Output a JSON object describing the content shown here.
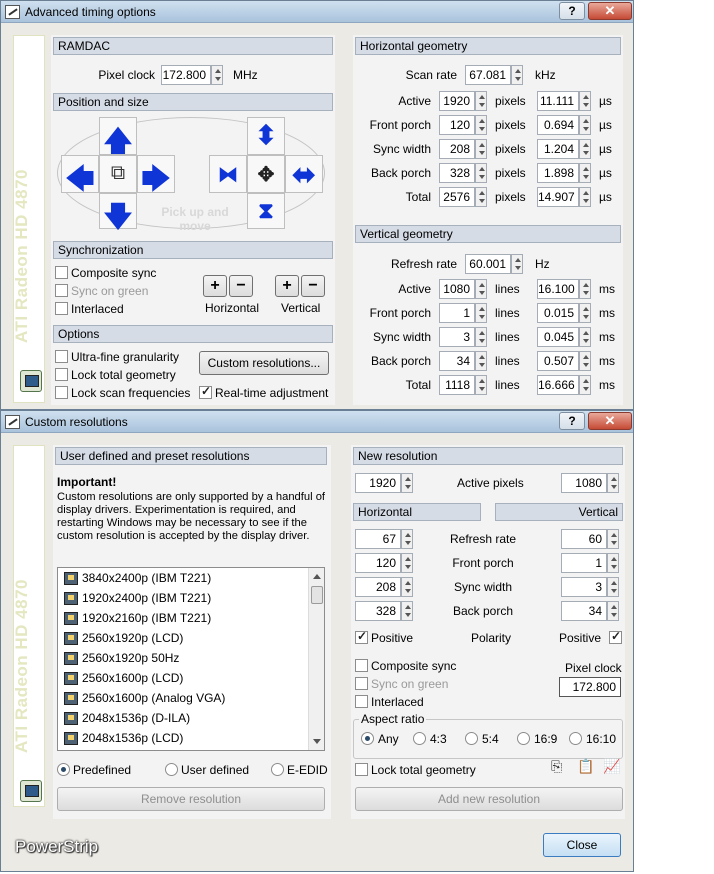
{
  "win1": {
    "title": "Advanced timing options",
    "help": "?",
    "close": "✕",
    "sidebar": "ATI Radeon HD 4870",
    "ramdac": {
      "header": "RAMDAC",
      "pixel_clock_label": "Pixel clock",
      "pixel_clock": "172.800",
      "unit": "MHz"
    },
    "position": {
      "header": "Position and size",
      "pickup": "Pick up and move"
    },
    "sync": {
      "header": "Synchronization",
      "composite": "Composite sync",
      "sync_on_green": "Sync on green",
      "interlaced": "Interlaced",
      "horizontal": "Horizontal",
      "vertical": "Vertical",
      "plus": "+",
      "minus": "−"
    },
    "options": {
      "header": "Options",
      "ultra_fine": "Ultra-fine granularity",
      "lock_total": "Lock total geometry",
      "lock_scan": "Lock scan frequencies",
      "custom_btn": "Custom resolutions...",
      "realtime": "Real-time adjustment"
    },
    "hgeo": {
      "header": "Horizontal geometry",
      "scan_label": "Scan rate",
      "scan": "67.081",
      "scan_unit": "kHz",
      "rows": [
        {
          "label": "Active",
          "value": "1920",
          "unit": "pixels",
          "time": "11.111",
          "tunit": "µs"
        },
        {
          "label": "Front porch",
          "value": "120",
          "unit": "pixels",
          "time": "0.694",
          "tunit": "µs"
        },
        {
          "label": "Sync width",
          "value": "208",
          "unit": "pixels",
          "time": "1.204",
          "tunit": "µs"
        },
        {
          "label": "Back porch",
          "value": "328",
          "unit": "pixels",
          "time": "1.898",
          "tunit": "µs"
        },
        {
          "label": "Total",
          "value": "2576",
          "unit": "pixels",
          "time": "14.907",
          "tunit": "µs"
        }
      ]
    },
    "vgeo": {
      "header": "Vertical geometry",
      "refresh_label": "Refresh rate",
      "refresh": "60.001",
      "refresh_unit": "Hz",
      "rows": [
        {
          "label": "Active",
          "value": "1080",
          "unit": "lines",
          "time": "16.100",
          "tunit": "ms"
        },
        {
          "label": "Front porch",
          "value": "1",
          "unit": "lines",
          "time": "0.015",
          "tunit": "ms"
        },
        {
          "label": "Sync width",
          "value": "3",
          "unit": "lines",
          "time": "0.045",
          "tunit": "ms"
        },
        {
          "label": "Back porch",
          "value": "34",
          "unit": "lines",
          "time": "0.507",
          "tunit": "ms"
        },
        {
          "label": "Total",
          "value": "1118",
          "unit": "lines",
          "time": "16.666",
          "tunit": "ms"
        }
      ]
    }
  },
  "win2": {
    "title": "Custom resolutions",
    "help": "?",
    "close": "✕",
    "sidebar": "ATI Radeon HD 4870",
    "brand": "PowerStrip",
    "left": {
      "header": "User defined and preset resolutions",
      "important": "Important!",
      "note": "Custom resolutions are only supported by a handful of display drivers. Experimentation is required, and restarting Windows may be necessary to see if the custom resolution is accepted by the display driver.",
      "list": [
        "3840x2400p (IBM T221)",
        "1920x2400p (IBM T221)",
        "1920x2160p (IBM T221)",
        "2560x1920p (LCD)",
        "2560x1920p 50Hz",
        "2560x1600p (LCD)",
        "2560x1600p (Analog VGA)",
        "2048x1536p (D-ILA)",
        "2048x1536p (LCD)"
      ],
      "predefined": "Predefined",
      "user_defined": "User defined",
      "eedid": "E-EDID",
      "remove": "Remove resolution"
    },
    "right": {
      "header": "New resolution",
      "width": "1920",
      "active_label": "Active pixels",
      "height": "1080",
      "h_header": "Horizontal",
      "v_header": "Vertical",
      "rows": [
        {
          "h": "67",
          "label": "Refresh rate",
          "v": "60"
        },
        {
          "h": "120",
          "label": "Front porch",
          "v": "1"
        },
        {
          "h": "208",
          "label": "Sync width",
          "v": "3"
        },
        {
          "h": "328",
          "label": "Back porch",
          "v": "34"
        }
      ],
      "pos_left": "Positive",
      "polarity": "Polarity",
      "pos_right": "Positive",
      "composite": "Composite sync",
      "sync_on_green": "Sync on green",
      "interlaced": "Interlaced",
      "pixel_clock_label": "Pixel clock",
      "pixel_clock": "172.800",
      "aspect_label": "Aspect ratio",
      "aspect": [
        "Any",
        "4:3",
        "5:4",
        "16:9",
        "16:10"
      ],
      "lock_total": "Lock total geometry",
      "add": "Add new resolution",
      "close_btn": "Close"
    }
  }
}
